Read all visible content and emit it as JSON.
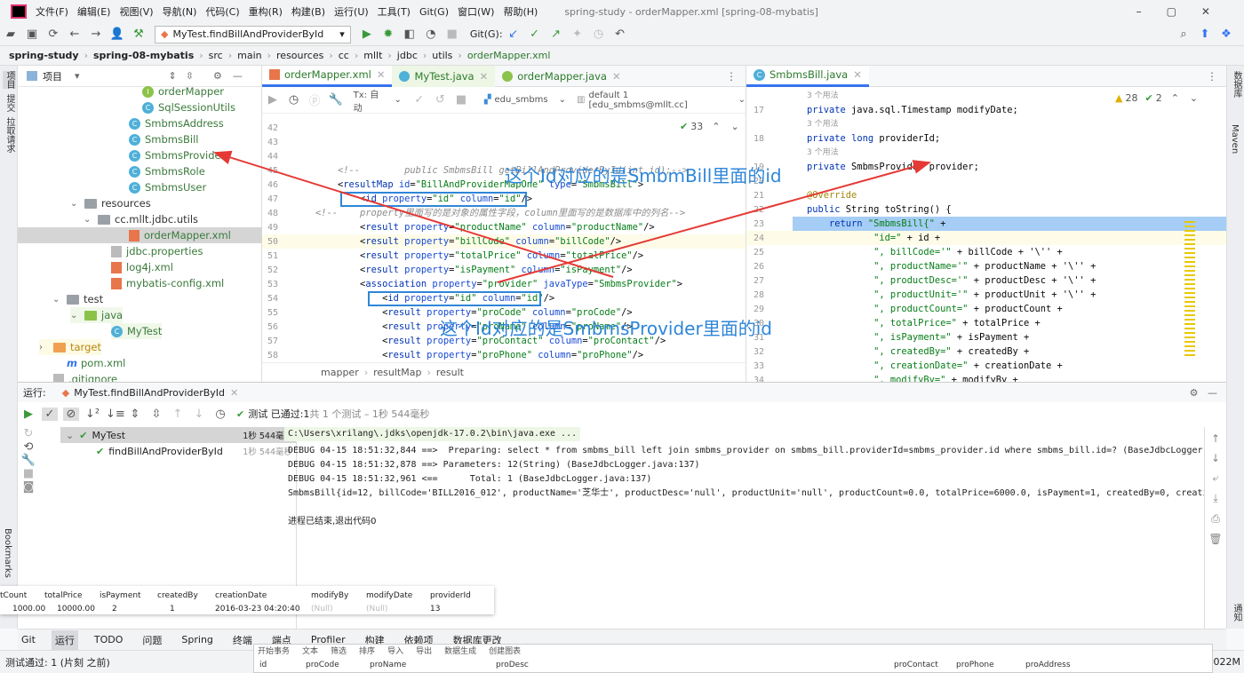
{
  "menu": {
    "items": [
      "文件(F)",
      "编辑(E)",
      "视图(V)",
      "导航(N)",
      "代码(C)",
      "重构(R)",
      "构建(B)",
      "运行(U)",
      "工具(T)",
      "Git(G)",
      "窗口(W)",
      "帮助(H)"
    ],
    "title": "spring-study - orderMapper.xml [spring-08-mybatis]"
  },
  "toolbar": {
    "run_config": "MyTest.findBillAndProviderById",
    "git_label": "Git(G):"
  },
  "breadcrumbs": [
    "spring-study",
    "spring-08-mybatis",
    "src",
    "main",
    "resources",
    "cc",
    "mllt",
    "jdbc",
    "utils",
    "orderMapper.xml"
  ],
  "left_stripe": [
    "项目",
    "提交",
    "拉取请求",
    "Bookmarks"
  ],
  "right_stripe": [
    "数据库",
    "Maven",
    "通知"
  ],
  "project": {
    "title": "项目",
    "items": [
      {
        "label": "orderMapper",
        "icon": "interface"
      },
      {
        "label": "SqlSessionUtils",
        "icon": "class"
      },
      {
        "label": "SmbmsAddress",
        "icon": "class"
      },
      {
        "label": "SmbmsBill",
        "icon": "class"
      },
      {
        "label": "SmbmsProvider",
        "icon": "class"
      },
      {
        "label": "SmbmsRole",
        "icon": "class"
      },
      {
        "label": "SmbmsUser",
        "icon": "class"
      },
      {
        "label": "resources",
        "icon": "folder"
      },
      {
        "label": "cc.mllt.jdbc.utils",
        "icon": "folder"
      },
      {
        "label": "orderMapper.xml",
        "icon": "xml"
      },
      {
        "label": "jdbc.properties",
        "icon": "properties"
      },
      {
        "label": "log4j.xml",
        "icon": "xml"
      },
      {
        "label": "mybatis-config.xml",
        "icon": "xml"
      },
      {
        "label": "test",
        "icon": "folder"
      },
      {
        "label": "java",
        "icon": "folder"
      },
      {
        "label": "MyTest",
        "icon": "class"
      },
      {
        "label": "target",
        "icon": "folder"
      },
      {
        "label": "pom.xml",
        "icon": "maven"
      },
      {
        "label": ".gitignore",
        "icon": "file"
      }
    ]
  },
  "editor_left": {
    "tabs": [
      "orderMapper.xml",
      "MyTest.java",
      "orderMapper.java"
    ],
    "db_toolbar": {
      "tx": "Tx: 自动",
      "schema": "edu_smbms",
      "session": "default 1 [edu_smbms@mllt.cc]"
    },
    "inspection_count": "33",
    "line_numbers": [
      "42",
      "43",
      "44",
      "45",
      "46",
      "47",
      "48",
      "49",
      "50",
      "51",
      "52",
      "53",
      "54",
      "55",
      "56",
      "57",
      "58"
    ],
    "lines": [
      "",
      "",
      "",
      "    <!--        public SmbmsBill getBillAndProviderById(int id);-->",
      "    <resultMap id=\"BillAndProviderMapOne\" type=\"SmbmsBill\">",
      "        <id property=\"id\" column=\"id\"/>",
      "<!--    property里面写的是对象的属性字段，column里面写的是数据库中的列名-->",
      "        <result property=\"productName\" column=\"productName\"/>",
      "        <result property=\"billCode\" column=\"billCode\"/>",
      "        <result property=\"totalPrice\" column=\"totalPrice\"/>",
      "        <result property=\"isPayment\" column=\"isPayment\"/>",
      "        <association property=\"provider\" javaType=\"SmbmsProvider\">",
      "            <id property=\"id\" column=\"id\"/>",
      "            <result property=\"proCode\" column=\"proCode\"/>",
      "            <result property=\"proName\" column=\"proName\"/>",
      "            <result property=\"proContact\" column=\"proContact\"/>",
      "            <result property=\"proPhone\" column=\"proPhone\"/>"
    ],
    "path": [
      "mapper",
      "resultMap",
      "result"
    ]
  },
  "editor_right": {
    "tab": "SmbmsBill.java",
    "warnings": "28",
    "checks": "2",
    "rows": [
      {
        "n": "",
        "t": "3 个用法",
        "u": true
      },
      {
        "n": "17",
        "t": "private java.sql.Timestamp modifyDate;"
      },
      {
        "n": "",
        "t": "3 个用法",
        "u": true
      },
      {
        "n": "18",
        "t": "private long providerId;"
      },
      {
        "n": "",
        "t": "3 个用法",
        "u": true
      },
      {
        "n": "19",
        "t": "private SmbmsProvider provider;"
      },
      {
        "n": "20",
        "t": ""
      },
      {
        "n": "21",
        "t": "@Override"
      },
      {
        "n": "22",
        "t": "public String toString() {"
      },
      {
        "n": "23",
        "t": "    return \"SmbmsBill{\" +"
      },
      {
        "n": "24",
        "t": "            \"id=\" + id +"
      },
      {
        "n": "25",
        "t": "            \", billCode='\" + billCode + '\\'' +"
      },
      {
        "n": "26",
        "t": "            \", productName='\" + productName + '\\'' +"
      },
      {
        "n": "27",
        "t": "            \", productDesc='\" + productDesc + '\\'' +"
      },
      {
        "n": "28",
        "t": "            \", productUnit='\" + productUnit + '\\'' +"
      },
      {
        "n": "29",
        "t": "            \", productCount=\" + productCount +"
      },
      {
        "n": "30",
        "t": "            \", totalPrice=\" + totalPrice +"
      },
      {
        "n": "31",
        "t": "            \", isPayment=\" + isPayment +"
      },
      {
        "n": "32",
        "t": "            \", createdBy=\" + createdBy +"
      },
      {
        "n": "33",
        "t": "            \", creationDate=\" + creationDate +"
      },
      {
        "n": "34",
        "t": "            \", modifyBy=\" + modifyBy +"
      }
    ]
  },
  "annotations": {
    "note1": "这个Id对应的是SmbmBill里面的id",
    "note2": "这个Id对应的是SmbmsProvider里面的id",
    "color": "#2f86d8",
    "arrow_color": "#e53935"
  },
  "run": {
    "label": "运行:",
    "tab": "MyTest.findBillAndProviderById",
    "status_prefix": "测试 已通过:",
    "status_count": "1",
    "status_rest": "共 1 个测试 – 1秒 544毫秒",
    "tree": [
      {
        "label": "MyTest",
        "time": "1秒 544毫秒"
      },
      {
        "label": "findBillAndProviderById",
        "time": "1秒 544毫秒"
      }
    ],
    "console": [
      "C:\\Users\\xrilang\\.jdks\\openjdk-17.0.2\\bin\\java.exe ...",
      "DEBUG 04-15 18:51:32,844 ==>  Preparing: select * from smbms_bill left join smbms_provider on smbms_bill.providerId=smbms_provider.id where smbms_bill.id=? (BaseJdbcLogger.java:",
      "DEBUG 04-15 18:51:32,878 ==> Parameters: 12(String) (BaseJdbcLogger.java:137)",
      "DEBUG 04-15 18:51:32,961 <==      Total: 1 (BaseJdbcLogger.java:137)",
      "SmbmsBill{id=12, billCode='BILL2016_012', productName='芝华士', productDesc='null', productUnit='null', productCount=0.0, totalPrice=6000.0, isPayment=1, createdBy=0, creationDat",
      "",
      "进程已结束,退出代码0"
    ]
  },
  "db_grid": {
    "headers": [
      "tCount",
      "totalPrice",
      "isPayment",
      "createdBy",
      "creationDate",
      "modifyBy",
      "modifyDate",
      "providerId"
    ],
    "row": [
      "1000.00",
      "10000.00",
      "2",
      "1",
      "2016-03-23 04:20:40",
      "(Null)",
      "(Null)",
      "13"
    ]
  },
  "bottom_tools": [
    "Git",
    "运行",
    "TODO",
    "问题",
    "Spring",
    "终端",
    "端点",
    "Profiler",
    "构建",
    "依赖项",
    "数据库更改"
  ],
  "status": {
    "text": "测试通过: 1 (片刻 之前)",
    "memory": "022M"
  },
  "popup": {
    "toolbar": [
      "开始事务",
      "文本",
      "筛选",
      "排序",
      "导入",
      "导出",
      "数据生成",
      "创建图表"
    ],
    "headers": [
      "id",
      "proCode",
      "proName",
      "proDesc",
      "proContact",
      "proPhone",
      "proAddress"
    ]
  }
}
